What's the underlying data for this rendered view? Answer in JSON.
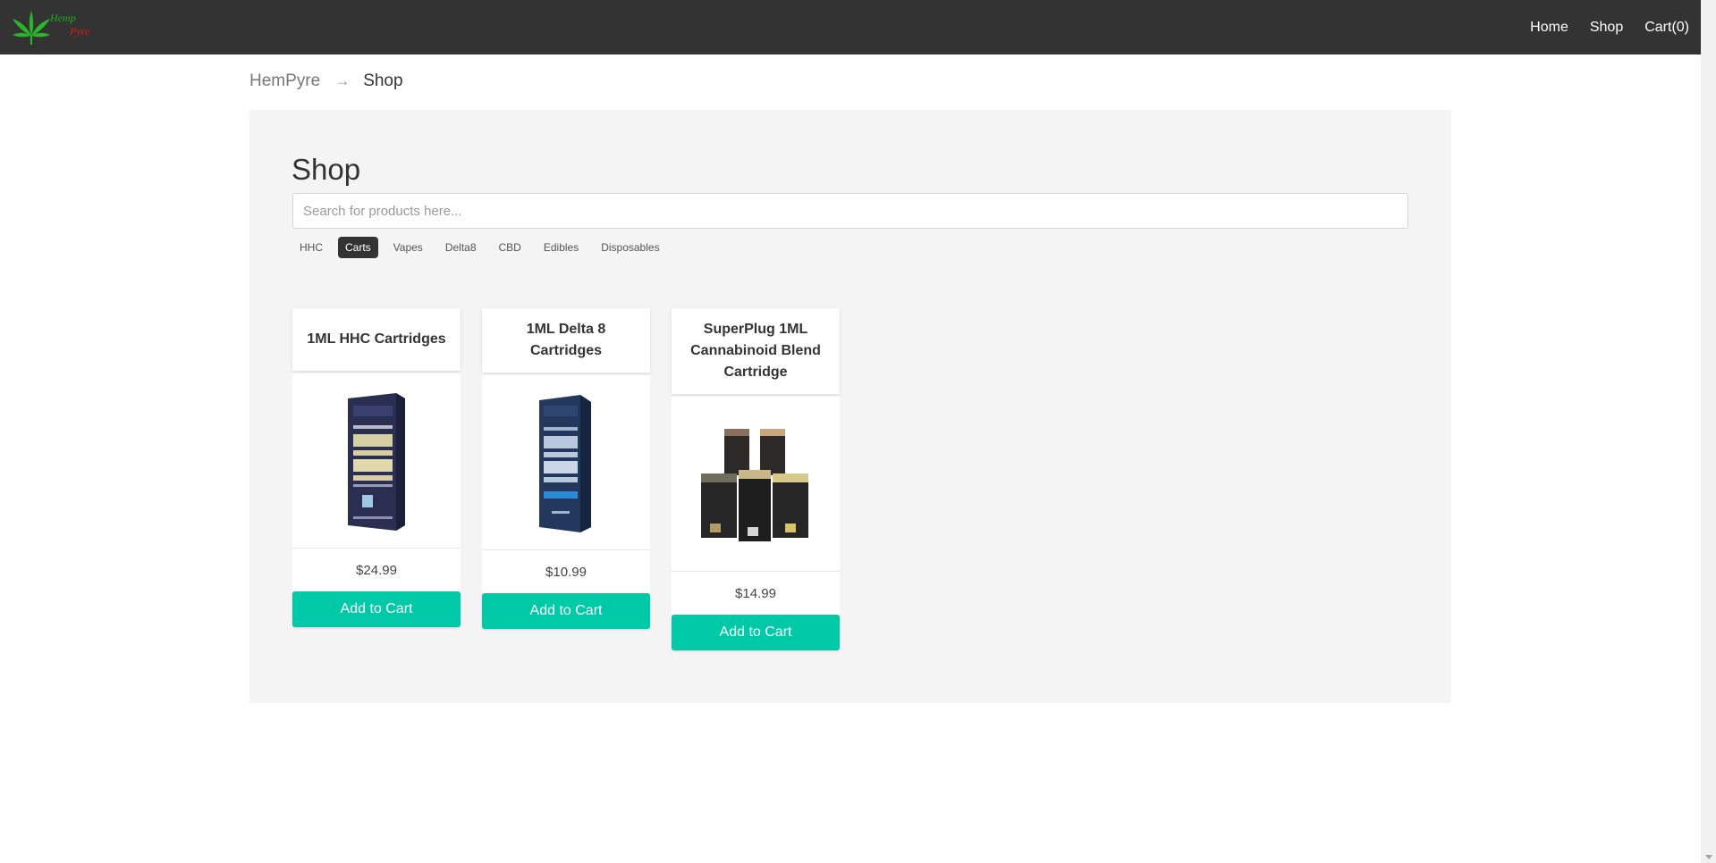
{
  "navbar": {
    "brand_top": "Hemp",
    "brand_bottom": "Pyre",
    "links": {
      "home": "Home",
      "shop": "Shop",
      "cart": "Cart(0)"
    }
  },
  "breadcrumb": {
    "home": "HemPyre",
    "separator": "→",
    "current": "Shop"
  },
  "shop": {
    "title": "Shop",
    "search_placeholder": "Search for products here...",
    "filters": [
      "HHC",
      "Carts",
      "Vapes",
      "Delta8",
      "CBD",
      "Edibles",
      "Disposables"
    ],
    "active_filter": "Carts"
  },
  "products": [
    {
      "name": "1ML HHC Cartridges",
      "price": "$24.99",
      "button": "Add to Cart",
      "image_icon": "tendc-hemp-vape-box"
    },
    {
      "name": "1ML Delta 8 Cartridges",
      "price": "$10.99",
      "button": "Add to Cart",
      "image_icon": "tendc-hemp-vape-box-blue"
    },
    {
      "name": "SuperPlug 1ML Cannabinoid Blend Cartridge",
      "price": "$14.99",
      "button": "Add to Cart",
      "image_icon": "cartridge-boxes-group"
    }
  ],
  "colors": {
    "navbar": "#333333",
    "accent": "#00c9a7",
    "panel": "#f4f4f4"
  }
}
